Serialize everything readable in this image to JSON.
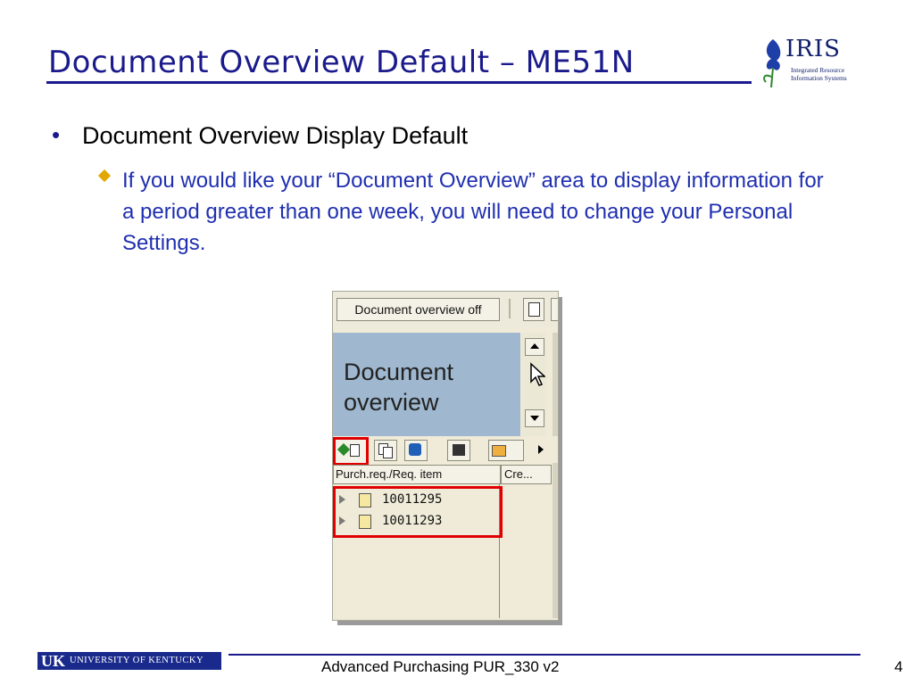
{
  "slide": {
    "title": "Document Overview Default – ME51N",
    "logo": {
      "word": "IRIS",
      "subtitle": "Integrated Resource Information Systems"
    },
    "bullet_level1": "Document Overview Display Default",
    "bullet_level2": "If you would like your “Document Overview” area to  display information for a period greater than one week, you will need to change your Personal Settings.",
    "colors": {
      "title": "#1a1a8c",
      "subbullet_text": "#1f2fb0",
      "diamond": "#e0a800",
      "highlight_box": "#e00000"
    }
  },
  "sap_screenshot": {
    "toolbar_button": "Document overview off",
    "panel_title": "Document overview",
    "icons": [
      "variant-select-icon",
      "copy-icon",
      "refresh-icon",
      "find-icon",
      "layout-icon"
    ],
    "columns": [
      "Purch.req./Req. item",
      "Cre..."
    ],
    "rows": [
      "10011295",
      "10011293"
    ]
  },
  "footer": {
    "logo_uk": "UK",
    "logo_text": "UNIVERSITY OF KENTUCKY",
    "course": "Advanced Purchasing PUR_330 v2",
    "page": "4"
  }
}
